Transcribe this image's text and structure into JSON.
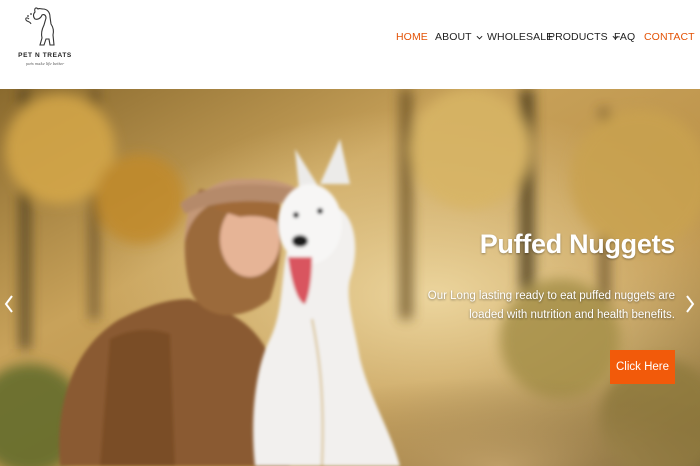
{
  "brand": {
    "name": "PET N TREATS",
    "tagline": "pets make life better"
  },
  "nav": {
    "items": [
      {
        "label": "HOME",
        "active": true,
        "has_dropdown": false
      },
      {
        "label": "ABOUT",
        "active": false,
        "has_dropdown": true
      },
      {
        "label": "WHOLESALE",
        "active": false,
        "has_dropdown": false
      },
      {
        "label": "PRODUCTS",
        "active": false,
        "has_dropdown": true
      },
      {
        "label": "FAQ",
        "active": false,
        "has_dropdown": false
      },
      {
        "label": "CONTACT",
        "active": true,
        "has_dropdown": false
      }
    ]
  },
  "hero": {
    "title": "Puffed Nuggets",
    "description": "Our Long lasting ready to eat puffed nuggets are loaded with nutrition and health benefits.",
    "cta_label": "Click Here",
    "prev_icon": "chevron-left-icon",
    "next_icon": "chevron-right-icon"
  },
  "colors": {
    "accent": "#e35205",
    "button": "#f25a0a",
    "nav_text": "#222222"
  }
}
